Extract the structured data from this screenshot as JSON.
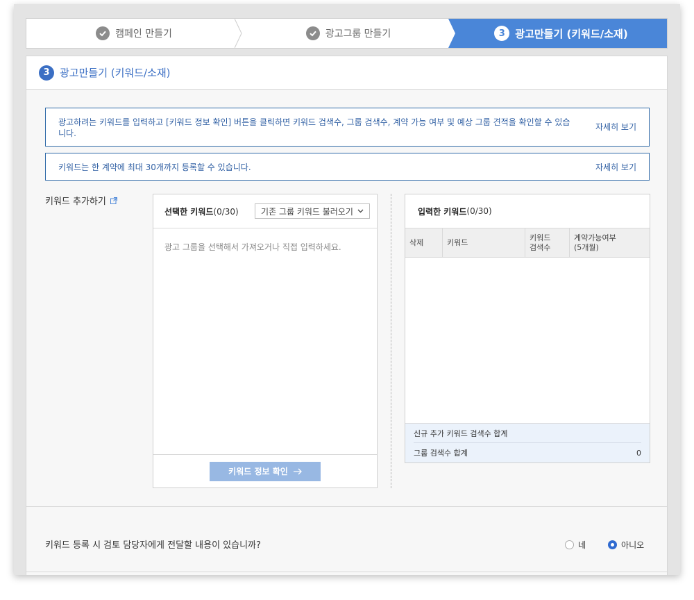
{
  "stepper": {
    "steps": [
      {
        "label": "캠페인 만들기",
        "state": "done"
      },
      {
        "label": "광고그룹 만들기",
        "state": "done"
      },
      {
        "label": "광고만들기 (키워드/소재)",
        "state": "active",
        "number": "3"
      }
    ]
  },
  "panel": {
    "number": "3",
    "title": "광고만들기 (키워드/소재)"
  },
  "notices": [
    {
      "text": "광고하려는 키워드를 입력하고 [키워드 정보 확인] 버튼을 클릭하면 키워드 검색수, 그룹 검색수, 계약 가능 여부 및 예상 그룹 견적을 확인할 수 있습니다.",
      "link": "자세히 보기"
    },
    {
      "text": "키워드는 한 계약에 최대 30개까지 등록할 수 있습니다.",
      "link": "자세히 보기"
    }
  ],
  "keyword_add": {
    "label": "키워드 추가하기"
  },
  "selected_box": {
    "title": "선택한 키워드",
    "count": "(0/30)",
    "dropdown": "기존 그룹 키워드 불러오기",
    "placeholder": "광고 그룹을 선택해서 가져오거나 직접 입력하세요.",
    "confirm_button": "키워드 정보 확인"
  },
  "input_box": {
    "title": "입력한 키워드",
    "count": "(0/30)",
    "columns": [
      "삭제",
      "키워드",
      "키워드\n검색수",
      "계약가능여부\n(5개월)"
    ],
    "sum_rows": [
      {
        "label": "신규 추가 키워드 검색수 합계",
        "value": ""
      },
      {
        "label": "그룹 검색수 합계",
        "value": "0"
      }
    ]
  },
  "review": {
    "question": "키워드 등록 시 검토 담당자에게 전달할 내용이 있습니까?",
    "options": [
      {
        "label": "네",
        "selected": false
      },
      {
        "label": "아니오",
        "selected": true
      }
    ]
  },
  "colors": {
    "accent": "#4a86d8",
    "link": "#2f5fa3",
    "button_disabled": "#98b8e3"
  }
}
